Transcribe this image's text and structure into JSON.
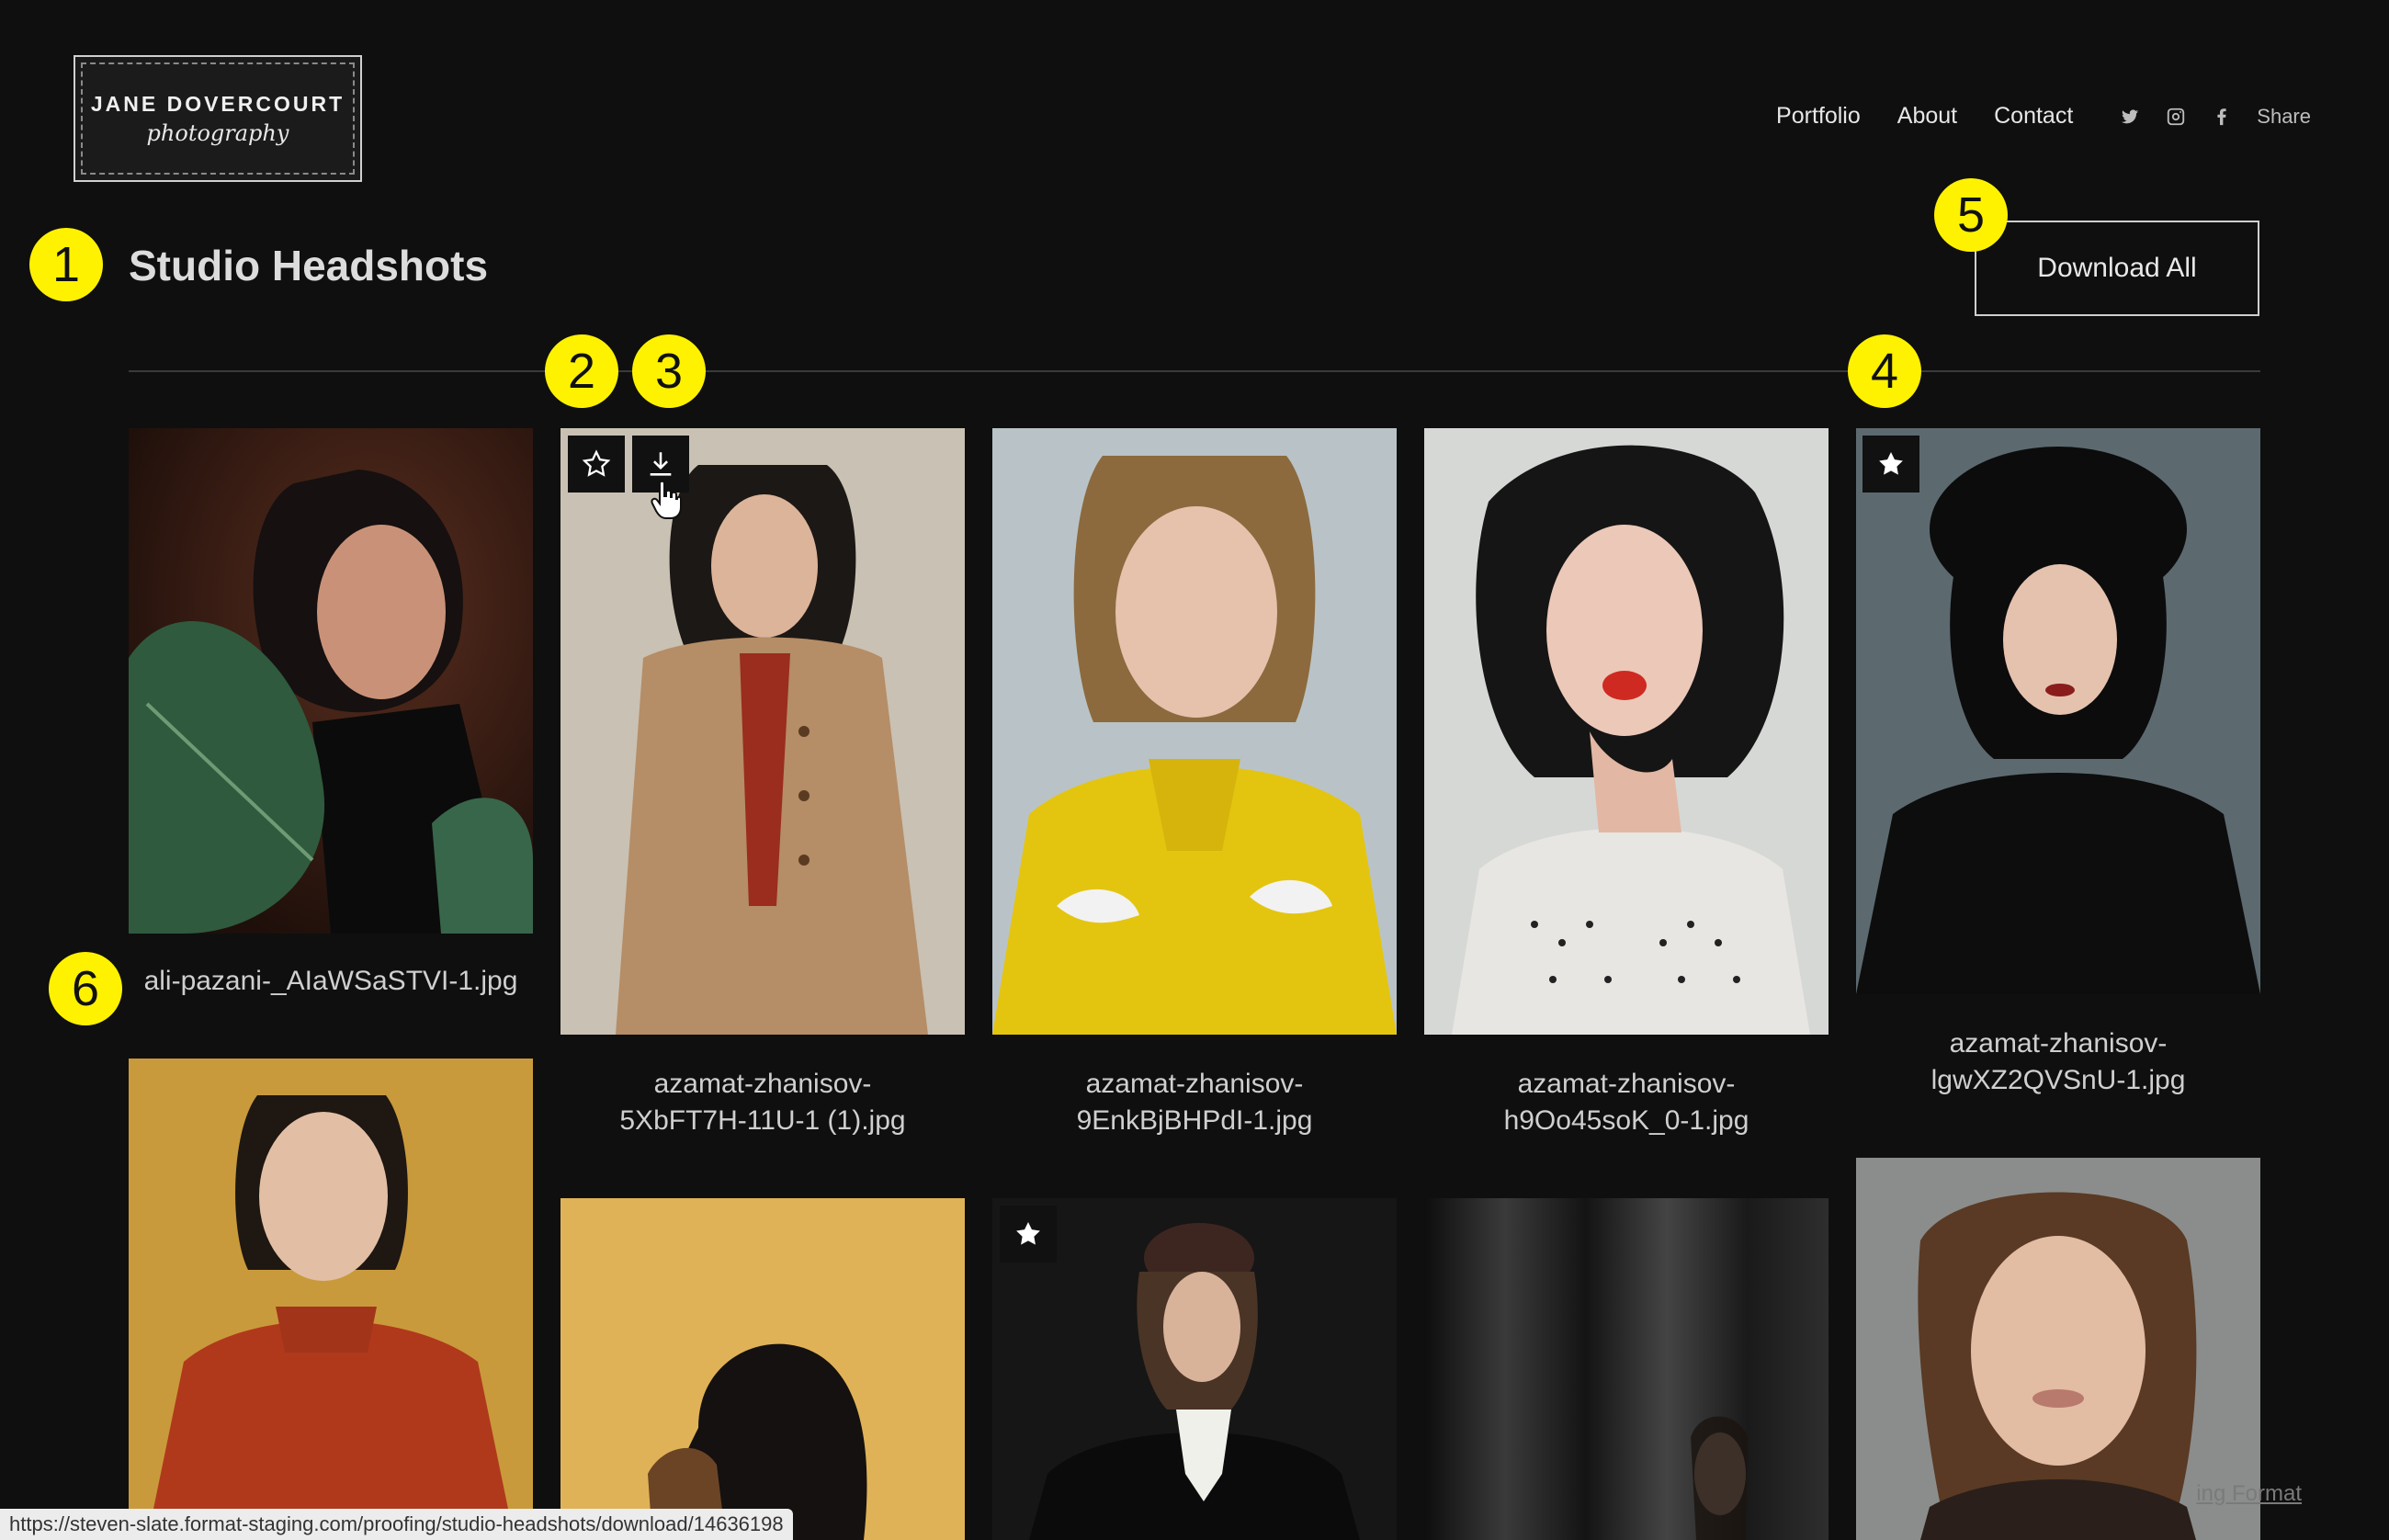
{
  "brand": {
    "name": "JANE DOVERCOURT",
    "tagline": "photography"
  },
  "nav": {
    "links": [
      "Portfolio",
      "About",
      "Contact"
    ],
    "share_label": "Share"
  },
  "social_icons": [
    "twitter-icon",
    "instagram-icon",
    "facebook-icon"
  ],
  "gallery": {
    "title": "Studio Headshots",
    "download_all_label": "Download All"
  },
  "badges": [
    "1",
    "2",
    "3",
    "4",
    "5",
    "6"
  ],
  "photos": [
    {
      "caption_1": "ali-pazani-_AIaWSaSTVI-1.jpg",
      "caption_2": "",
      "favorited": false
    },
    {
      "caption_1": "azamat-zhanisov-",
      "caption_2": "5XbFT7H-11U-1 (1).jpg",
      "favorited": false,
      "hovered": true
    },
    {
      "caption_1": "azamat-zhanisov-",
      "caption_2": "9EnkBjBHPdI-1.jpg",
      "favorited": false
    },
    {
      "caption_1": "azamat-zhanisov-",
      "caption_2": "h9Oo45soK_0-1.jpg",
      "favorited": false
    },
    {
      "caption_1": "azamat-zhanisov-",
      "caption_2": "lgwXZ2QVSnU-1.jpg",
      "favorited": true
    },
    {
      "favorited": false
    },
    {
      "favorited": false
    },
    {
      "favorited": true
    },
    {
      "favorited": false
    },
    {
      "favorited": false
    }
  ],
  "status_bar": {
    "url": "https://steven-slate.format-staging.com/proofing/studio-headshots/download/14636198"
  },
  "footer": {
    "credit": "ing Format"
  },
  "colors": {
    "background": "#0f0f0f",
    "badge": "#fff200",
    "text": "#d8d8d8"
  }
}
